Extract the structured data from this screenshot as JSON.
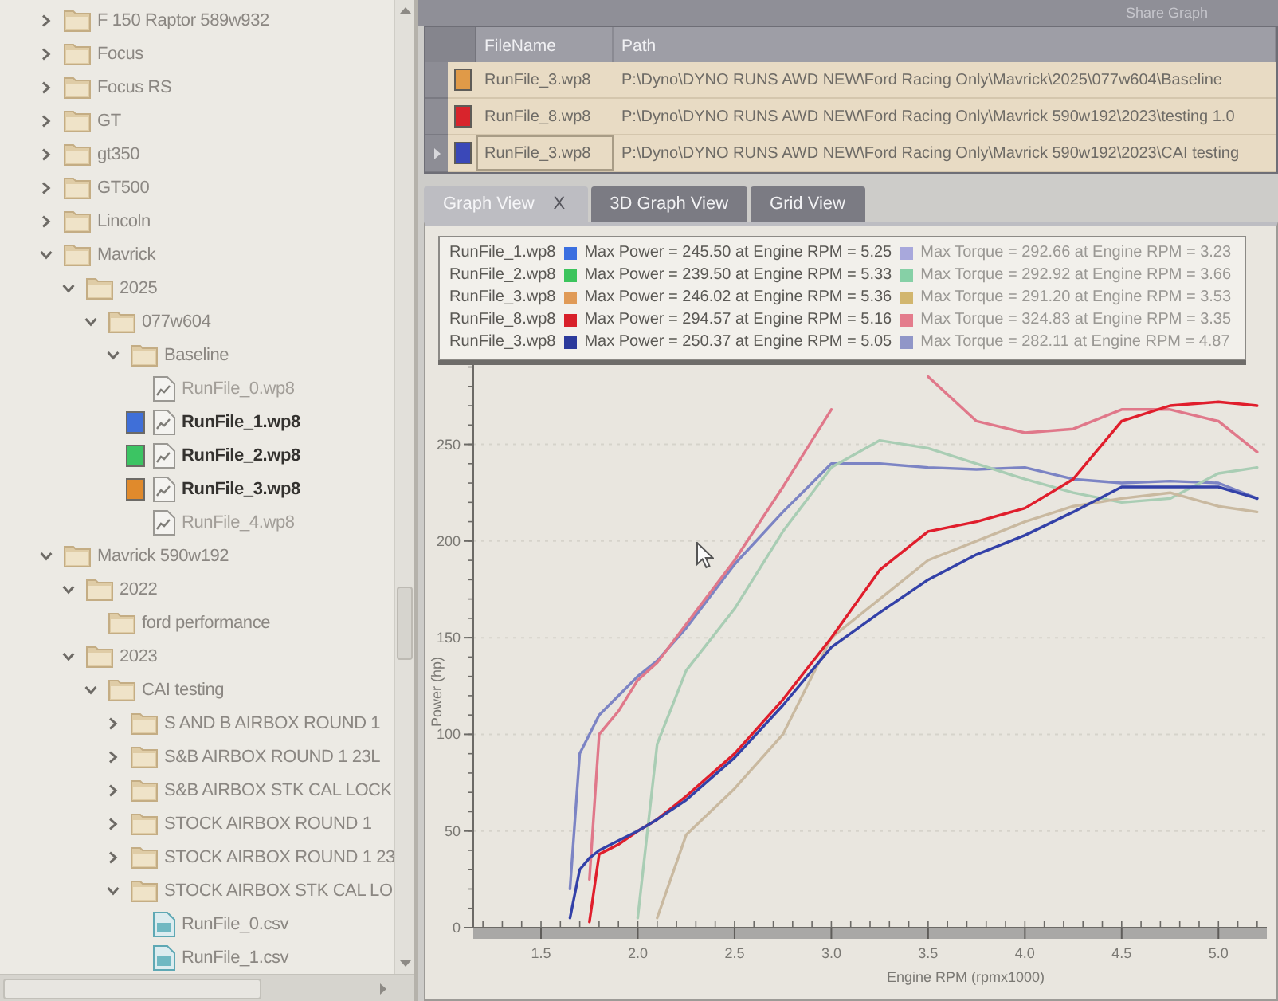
{
  "tree": {
    "items": [
      {
        "kind": "folder",
        "label": "F 150 Raptor 589w932",
        "expanded": false
      },
      {
        "kind": "folder",
        "label": "Focus",
        "expanded": false
      },
      {
        "kind": "folder",
        "label": "Focus RS",
        "expanded": false
      },
      {
        "kind": "folder",
        "label": "GT",
        "expanded": false
      },
      {
        "kind": "folder",
        "label": "gt350",
        "expanded": false
      },
      {
        "kind": "folder",
        "label": "GT500",
        "expanded": false
      },
      {
        "kind": "folder",
        "label": "Lincoln",
        "expanded": false
      },
      {
        "kind": "folder",
        "label": "Mavrick",
        "expanded": true,
        "children": [
          {
            "kind": "folder",
            "label": "2025",
            "expanded": true,
            "children": [
              {
                "kind": "folder",
                "label": "077w604",
                "expanded": true,
                "children": [
                  {
                    "kind": "folder",
                    "label": "Baseline",
                    "expanded": true,
                    "children": [
                      {
                        "kind": "run-file",
                        "label": "RunFile_0.wp8",
                        "selected": false
                      },
                      {
                        "kind": "run-file",
                        "label": "RunFile_1.wp8",
                        "selected": true,
                        "color": "#3f6fd8"
                      },
                      {
                        "kind": "run-file",
                        "label": "RunFile_2.wp8",
                        "selected": true,
                        "color": "#3cc463"
                      },
                      {
                        "kind": "run-file",
                        "label": "RunFile_3.wp8",
                        "selected": true,
                        "color": "#e08a2c"
                      },
                      {
                        "kind": "run-file",
                        "label": "RunFile_4.wp8",
                        "selected": false
                      }
                    ]
                  }
                ]
              }
            ]
          }
        ]
      },
      {
        "kind": "folder",
        "label": "Mavrick 590w192",
        "expanded": true,
        "children": [
          {
            "kind": "folder",
            "label": "2022",
            "expanded": true,
            "children": [
              {
                "kind": "folder",
                "label": "ford performance"
              }
            ]
          },
          {
            "kind": "folder",
            "label": "2023",
            "expanded": true,
            "children": [
              {
                "kind": "folder",
                "label": "CAI testing",
                "expanded": true,
                "children": [
                  {
                    "kind": "folder",
                    "label": "S AND B AIRBOX ROUND 1",
                    "expanded": false
                  },
                  {
                    "kind": "folder",
                    "label": "S&B AIRBOX ROUND 1 23L",
                    "expanded": false
                  },
                  {
                    "kind": "folder",
                    "label": "S&B AIRBOX STK CAL LOCK",
                    "expanded": false
                  },
                  {
                    "kind": "folder",
                    "label": "STOCK AIRBOX ROUND 1",
                    "expanded": false
                  },
                  {
                    "kind": "folder",
                    "label": "STOCK AIRBOX ROUND 1 23",
                    "expanded": false
                  },
                  {
                    "kind": "folder",
                    "label": "STOCK AIRBOX STK CAL LO",
                    "expanded": true,
                    "children": [
                      {
                        "kind": "csv-file",
                        "label": "RunFile_0.csv"
                      },
                      {
                        "kind": "csv-file",
                        "label": "RunFile_1.csv"
                      }
                    ]
                  }
                ]
              }
            ]
          }
        ]
      }
    ]
  },
  "toolbar": {
    "label": "Share Graph"
  },
  "files_table": {
    "columns": [
      "FileName",
      "Path"
    ],
    "rows": [
      {
        "color": "#e09a48",
        "file_name": "RunFile_3.wp8",
        "path": "P:\\Dyno\\DYNO RUNS AWD NEW\\Ford Racing Only\\Mavrick\\2025\\077w604\\Baseline",
        "selected": false
      },
      {
        "color": "#d8242c",
        "file_name": "RunFile_8.wp8",
        "path": "P:\\Dyno\\DYNO RUNS AWD NEW\\Ford Racing Only\\Mavrick 590w192\\2023\\testing 1.0",
        "selected": false
      },
      {
        "color": "#3a48b8",
        "file_name": "RunFile_3.wp8",
        "path": "P:\\Dyno\\DYNO RUNS AWD NEW\\Ford Racing Only\\Mavrick 590w192\\2023\\CAI testing",
        "selected": true
      }
    ]
  },
  "tabs": [
    {
      "label": "Graph View",
      "selected": true,
      "close": "X"
    },
    {
      "label": "3D Graph View",
      "selected": false
    },
    {
      "label": "Grid View",
      "selected": false
    }
  ],
  "graph": {
    "legend": [
      {
        "file": "RunFile_1.wp8",
        "power": {
          "text": "Max Power = 245.50 at Engine RPM = 5.25",
          "color": "#3b6fe0"
        },
        "torque": {
          "text": "Max Torque = 292.66 at Engine RPM = 3.23",
          "color": "#a8a8dc"
        }
      },
      {
        "file": "RunFile_2.wp8",
        "power": {
          "text": "Max Power = 239.50 at Engine RPM = 5.33",
          "color": "#3cc45c"
        },
        "torque": {
          "text": "Max Torque = 292.92 at Engine RPM = 3.66",
          "color": "#86d0a6"
        }
      },
      {
        "file": "RunFile_3.wp8",
        "power": {
          "text": "Max Power = 246.02 at Engine RPM = 5.36",
          "color": "#e09a56"
        },
        "torque": {
          "text": "Max Torque = 291.20 at Engine RPM = 3.53",
          "color": "#d2b66e"
        }
      },
      {
        "file": "RunFile_8.wp8",
        "power": {
          "text": "Max Power = 294.57 at Engine RPM = 5.16",
          "color": "#d8202a"
        },
        "torque": {
          "text": "Max Torque = 324.83 at Engine RPM = 3.35",
          "color": "#e47c8c"
        }
      },
      {
        "file": "RunFile_3.wp8",
        "power": {
          "text": "Max Power = 250.37 at Engine RPM = 5.05",
          "color": "#2c3a9c"
        },
        "torque": {
          "text": "Max Torque = 282.11 at Engine RPM = 4.87",
          "color": "#9096c8"
        }
      }
    ],
    "chart_data": {
      "type": "line",
      "xlabel": "Engine RPM (rpmx1000)",
      "ylabel": "Power (hp)",
      "grid": true,
      "x": [
        1.65,
        1.7,
        1.75,
        1.8,
        1.9,
        2.0,
        2.1,
        2.25,
        2.5,
        2.75,
        3.0,
        3.25,
        3.5,
        3.75,
        4.0,
        4.25,
        4.5,
        4.75,
        5.0,
        5.2
      ],
      "series": [
        {
          "color": "#7c84c4",
          "values": [
            20,
            90,
            100,
            110,
            120,
            130,
            138,
            155,
            188,
            215,
            240,
            240,
            238,
            237,
            238,
            232,
            230,
            231,
            230,
            222
          ]
        },
        {
          "color": "#e0788a",
          "values": [
            null,
            null,
            25,
            100,
            112,
            128,
            137,
            157,
            190,
            228,
            268,
            null,
            285,
            262,
            256,
            258,
            268,
            268,
            262,
            246
          ]
        },
        {
          "color": "#a9cdb4",
          "values": [
            null,
            null,
            null,
            null,
            null,
            5,
            95,
            133,
            165,
            205,
            238,
            252,
            248,
            240,
            232,
            225,
            220,
            222,
            235,
            238
          ]
        },
        {
          "color": "#c9b9a0",
          "values": [
            null,
            null,
            null,
            null,
            null,
            null,
            5,
            48,
            72,
            100,
            150,
            170,
            190,
            200,
            210,
            218,
            222,
            225,
            218,
            215
          ]
        },
        {
          "color": "#e01e2c",
          "values": [
            null,
            null,
            3,
            38,
            43,
            50,
            56,
            68,
            90,
            118,
            150,
            185,
            205,
            210,
            217,
            232,
            262,
            270,
            272,
            270
          ]
        },
        {
          "color": "#3341a8",
          "values": [
            5,
            30,
            36,
            40,
            45,
            50,
            56,
            66,
            88,
            115,
            145,
            163,
            180,
            193,
            203,
            215,
            228,
            228,
            228,
            222
          ]
        }
      ],
      "xlim": [
        1.15,
        5.25
      ],
      "ylim": [
        0,
        310
      ],
      "xticks": [
        {
          "value": 1.5,
          "label": "1.5"
        },
        {
          "value": 2,
          "label": "2.0"
        },
        {
          "value": 2.5,
          "label": "2.5"
        },
        {
          "value": 3,
          "label": "3.0"
        },
        {
          "value": 3.5,
          "label": "3.5"
        },
        {
          "value": 4,
          "label": "4.0"
        },
        {
          "value": 4.5,
          "label": "4.5"
        },
        {
          "value": 5,
          "label": "5.0"
        }
      ],
      "yticks": [
        0,
        50,
        100,
        150,
        200,
        250
      ]
    }
  }
}
